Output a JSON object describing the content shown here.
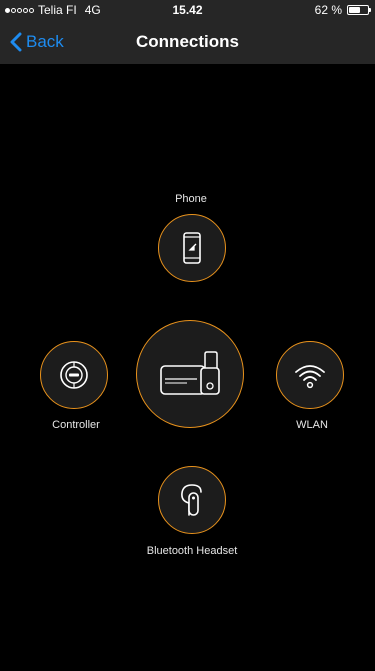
{
  "status_bar": {
    "carrier": "Telia FI",
    "network": "4G",
    "time": "15.42",
    "battery_text": "62 %",
    "battery_level": 0.62
  },
  "nav": {
    "back_label": "Back",
    "title": "Connections"
  },
  "nodes": {
    "phone": {
      "label": "Phone",
      "icon": "smartphone-icon"
    },
    "controller": {
      "label": "Controller",
      "icon": "controller-icon"
    },
    "wlan": {
      "label": "WLAN",
      "icon": "wifi-icon"
    },
    "headset": {
      "label": "Bluetooth Headset",
      "icon": "headset-icon"
    },
    "device": {
      "icon": "camera-device-icon"
    }
  },
  "colors": {
    "accent_ring": "#e8921c",
    "back_blue": "#1e8cf0",
    "bar_bg": "#262626",
    "background": "#000000"
  }
}
